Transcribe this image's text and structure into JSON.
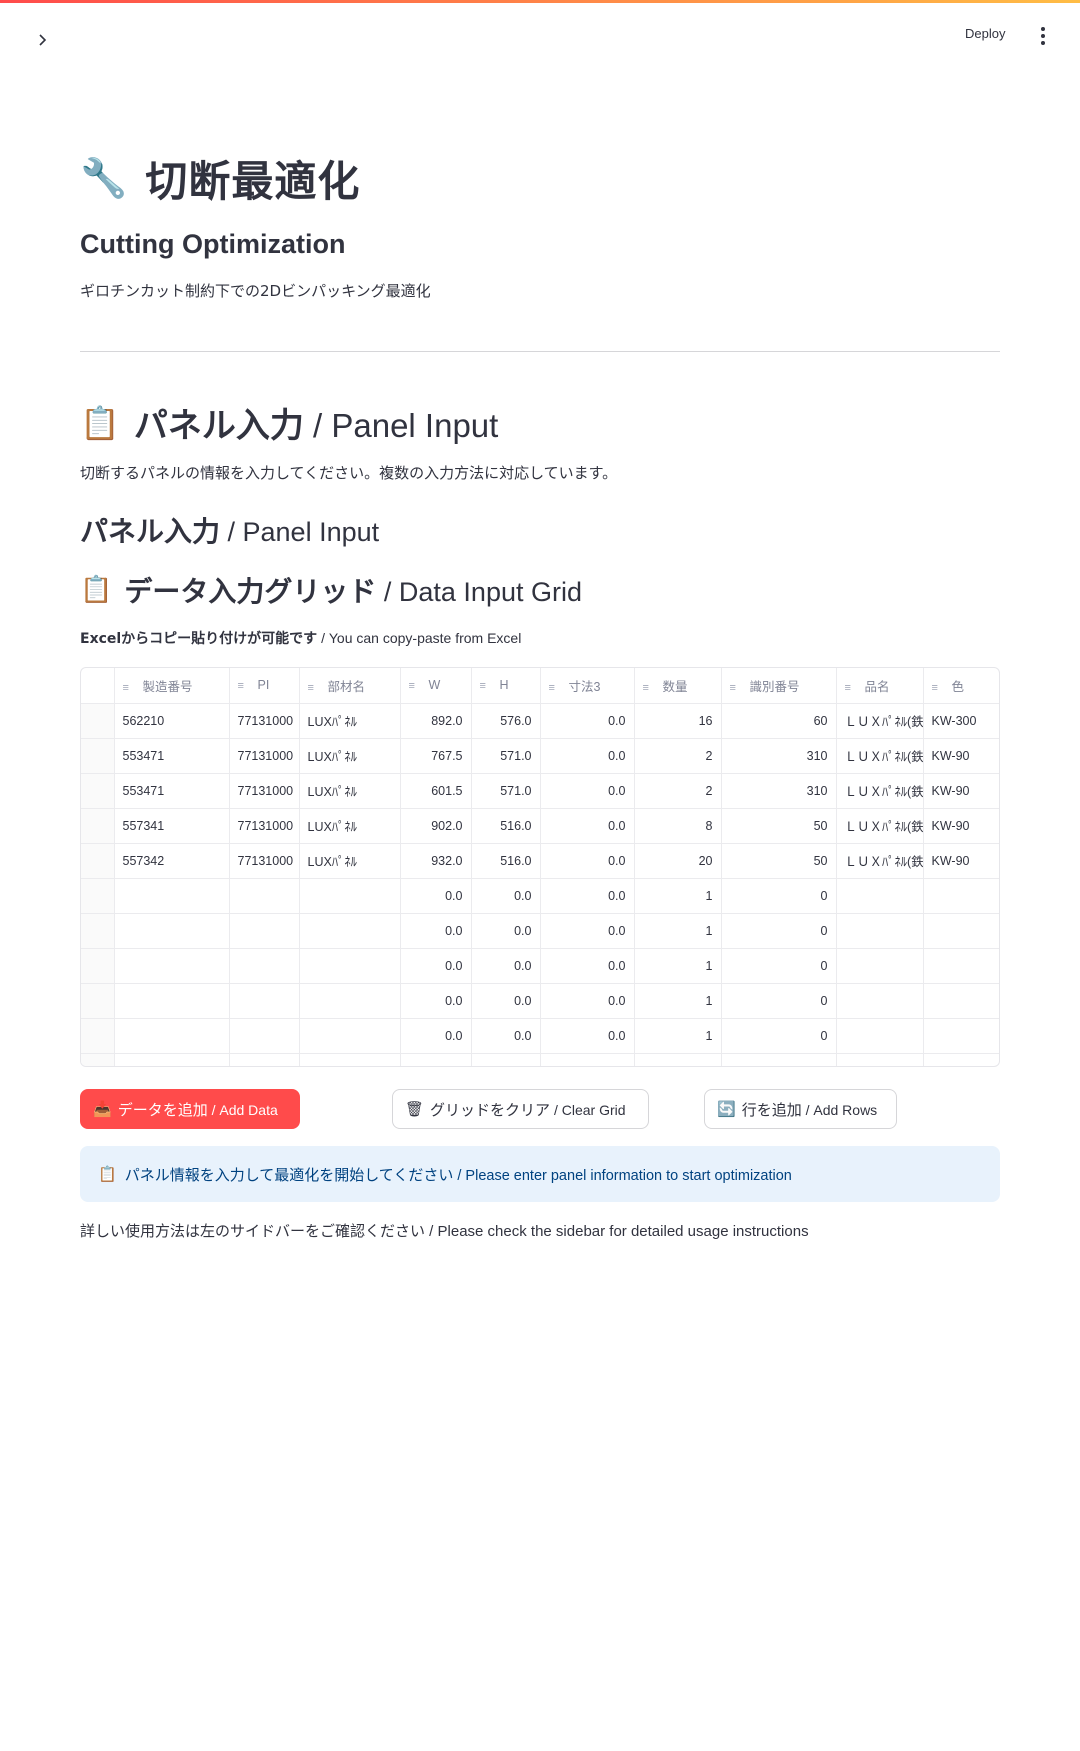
{
  "header": {
    "deploy_label": "Deploy",
    "sidebar_toggle_icon": "chevron-right-icon",
    "menu_icon": "more-vertical-icon"
  },
  "title": {
    "emoji": "🔧",
    "text": "切断最適化"
  },
  "subtitle": "Cutting Optimization",
  "caption": "ギロチンカット制約下での2Dビンパッキング最適化",
  "panel_section": {
    "emoji": "📋",
    "title_ja": "パネル入力",
    "title_en": " / Panel Input",
    "description": "切断するパネルの情報を入力してください。複数の入力方法に対応しています。"
  },
  "panel_subsection": {
    "title_ja": "パネル入力",
    "title_en": " / Panel Input"
  },
  "grid_section": {
    "emoji": "📋",
    "title_ja": "データ入力グリッド",
    "title_en": " / Data Input Grid",
    "hint_ja": "Excelからコピー貼り付けが可能です",
    "hint_en": " / You can copy-paste from Excel"
  },
  "grid": {
    "columns": [
      "製造番号",
      "PI",
      "部材名",
      "W",
      "H",
      "寸法3",
      "数量",
      "識別番号",
      "品名",
      "色"
    ],
    "rows": [
      [
        "562210",
        "77131000",
        "LUXﾊﾟﾈﾙ",
        "892.0",
        "576.0",
        "0.0",
        "16",
        "60",
        "ＬＵＸﾊﾟﾈﾙ(鉄",
        "KW-300"
      ],
      [
        "553471",
        "77131000",
        "LUXﾊﾟﾈﾙ",
        "767.5",
        "571.0",
        "0.0",
        "2",
        "310",
        "ＬＵＸﾊﾟﾈﾙ(鉄",
        "KW-90"
      ],
      [
        "553471",
        "77131000",
        "LUXﾊﾟﾈﾙ",
        "601.5",
        "571.0",
        "0.0",
        "2",
        "310",
        "ＬＵＸﾊﾟﾈﾙ(鉄",
        "KW-90"
      ],
      [
        "557341",
        "77131000",
        "LUXﾊﾟﾈﾙ",
        "902.0",
        "516.0",
        "0.0",
        "8",
        "50",
        "ＬＵＸﾊﾟﾈﾙ(鉄",
        "KW-90"
      ],
      [
        "557342",
        "77131000",
        "LUXﾊﾟﾈﾙ",
        "932.0",
        "516.0",
        "0.0",
        "20",
        "50",
        "ＬＵＸﾊﾟﾈﾙ(鉄",
        "KW-90"
      ],
      [
        "",
        "",
        "",
        "0.0",
        "0.0",
        "0.0",
        "1",
        "0",
        "",
        ""
      ],
      [
        "",
        "",
        "",
        "0.0",
        "0.0",
        "0.0",
        "1",
        "0",
        "",
        ""
      ],
      [
        "",
        "",
        "",
        "0.0",
        "0.0",
        "0.0",
        "1",
        "0",
        "",
        ""
      ],
      [
        "",
        "",
        "",
        "0.0",
        "0.0",
        "0.0",
        "1",
        "0",
        "",
        ""
      ],
      [
        "",
        "",
        "",
        "0.0",
        "0.0",
        "0.0",
        "1",
        "0",
        "",
        ""
      ]
    ]
  },
  "buttons": {
    "add_data_emoji": "📥",
    "add_data_ja": "データを追加",
    "add_data_en": " / Add Data",
    "clear_grid_emoji": "🗑",
    "clear_grid_ja": "グリッドをクリア",
    "clear_grid_en": " / Clear Grid",
    "add_rows_emoji": "🔄",
    "add_rows_ja": "行を追加",
    "add_rows_en": " / Add Rows"
  },
  "info": {
    "emoji": "📋",
    "text_ja": "パネル情報を入力して最適化を開始してください",
    "text_en": " / Please enter panel information to start optimization"
  },
  "footer": {
    "text_ja": "詳しい使用方法は左のサイドバーをご確認ください",
    "text_en": " / Please check the sidebar for detailed usage instructions"
  },
  "colors": {
    "primary": "#ff4b4b",
    "info_bg": "#e8f2fc",
    "info_text": "#004280",
    "text": "#31333f"
  }
}
